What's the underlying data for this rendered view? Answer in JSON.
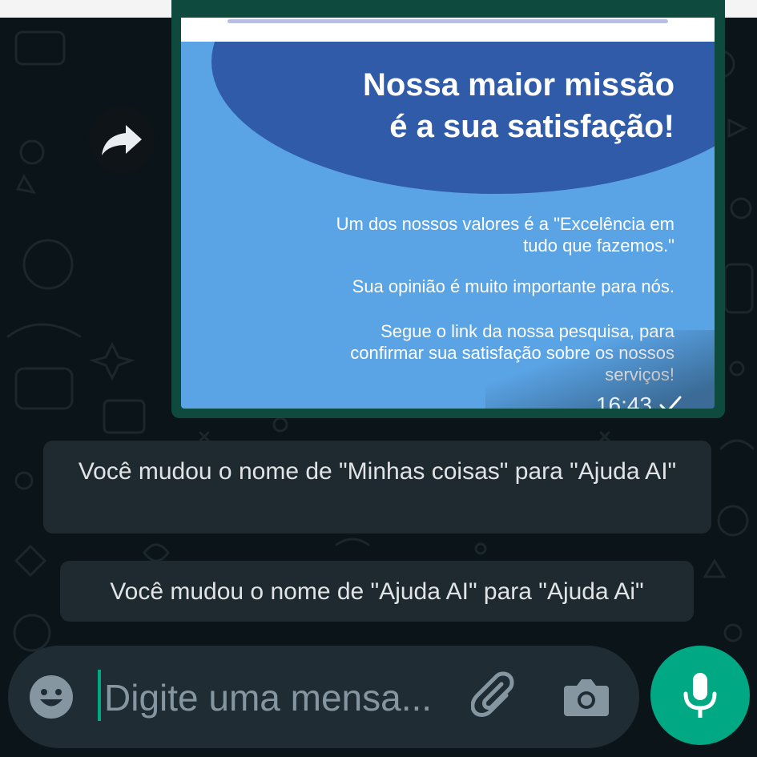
{
  "image_message": {
    "headline_line1": "Nossa maior missão",
    "headline_line2": "é a sua satisfação!",
    "body_line1": "Um dos nossos valores é a \"Excelência em",
    "body_line2": "tudo que fazemos.\"",
    "body_line3": "Sua opinião é muito importante para nós.",
    "body_line4": "Segue o link da nossa pesquisa, para",
    "body_line5": "confirmar sua satisfação sobre os nossos",
    "body_line6": "serviços!",
    "time": "16:43",
    "status_icon": "single-check-icon"
  },
  "system_messages": [
    {
      "text": "Você mudou o nome de \"Minhas coisas\" para \"Ajuda AI\""
    },
    {
      "text": "Você mudou o nome de \"Ajuda AI\" para \"Ajuda Ai\""
    }
  ],
  "composer": {
    "placeholder": "Digite uma mensa...",
    "icons": [
      "emoji-icon",
      "attach-icon",
      "camera-icon",
      "mic-icon"
    ]
  },
  "colors": {
    "accent": "#00a884",
    "bubble_outgoing": "#0e4a3e",
    "system_bubble": "#1f2a30",
    "input_bar": "#1f2c33",
    "background": "#0b1418"
  }
}
